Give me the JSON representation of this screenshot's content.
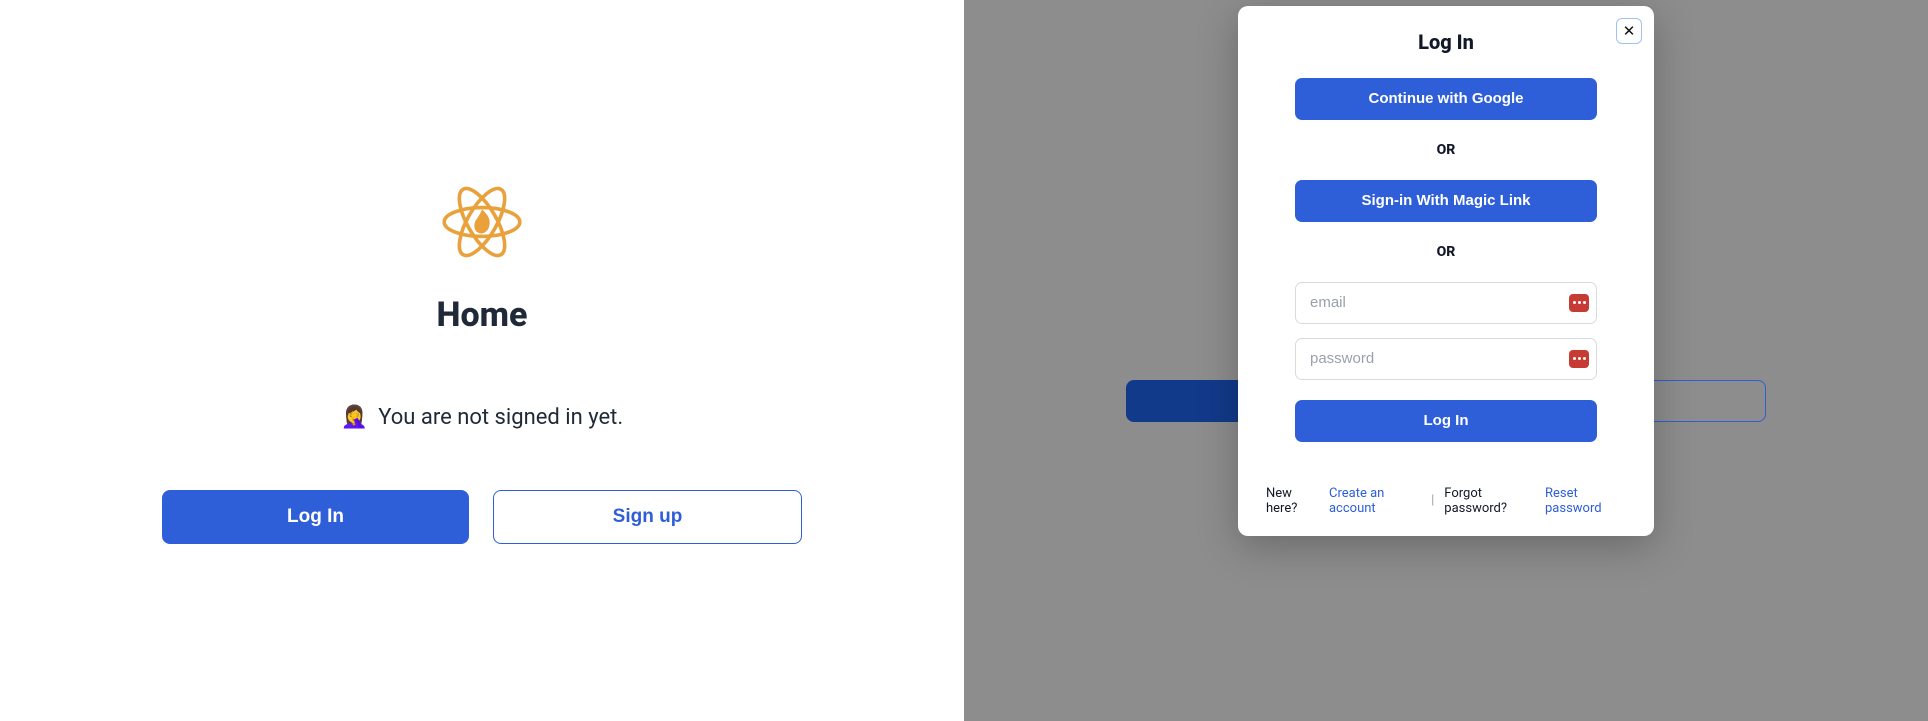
{
  "left": {
    "title": "Home",
    "status_emoji": "🤦‍♀️",
    "status_text": "You are not signed in yet.",
    "login_label": "Log In",
    "signup_label": "Sign up"
  },
  "modal": {
    "title": "Log In",
    "google_label": "Continue with Google",
    "or_label": "OR",
    "magic_link_label": "Sign-in With Magic Link",
    "email_placeholder": "email",
    "password_placeholder": "password",
    "submit_label": "Log In",
    "footer": {
      "new_prompt": "New here?",
      "create_link": "Create an account",
      "forgot_prompt": "Forgot password?",
      "reset_link": "Reset password"
    }
  },
  "colors": {
    "primary": "#2e5fd8",
    "overlay": "#8d8d8d"
  }
}
